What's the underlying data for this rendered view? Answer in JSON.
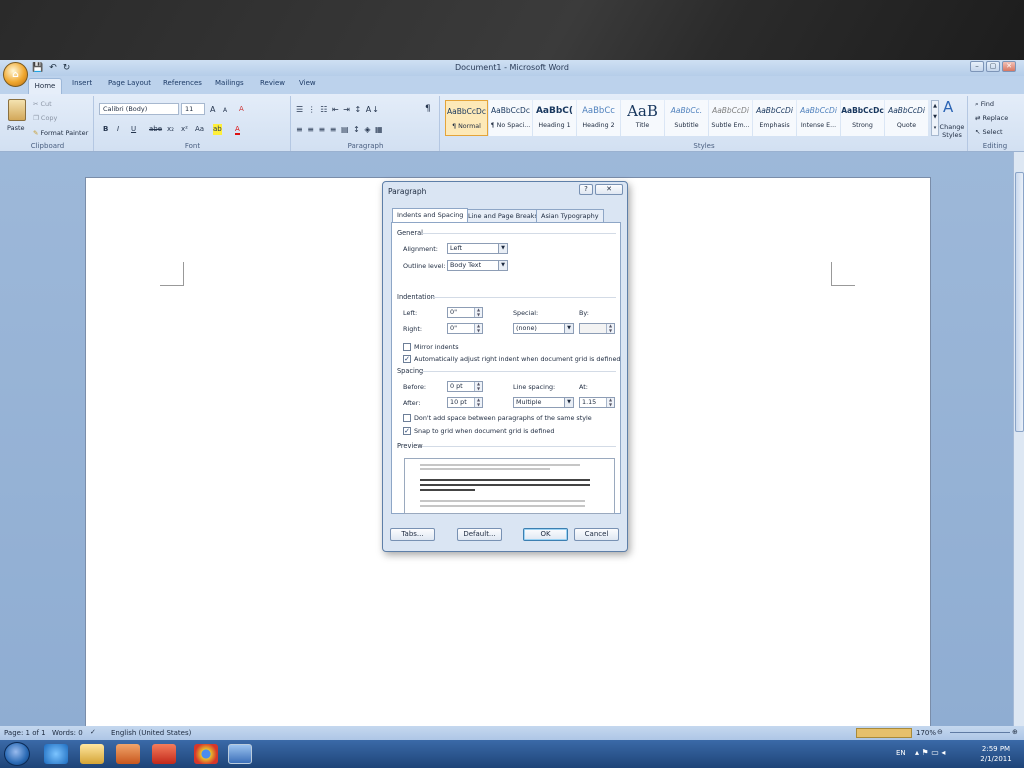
{
  "window": {
    "title": "Document1 - Microsoft Word",
    "controls": [
      "–",
      "▢",
      "✕"
    ]
  },
  "qat": {
    "save": "💾",
    "undo": "↶",
    "redo": "↻"
  },
  "office_button_label": "⌂",
  "tabs": [
    "Home",
    "Insert",
    "Page Layout",
    "References",
    "Mailings",
    "Review",
    "View"
  ],
  "ribbon": {
    "clipboard": {
      "paste": "Paste",
      "cut": "Cut",
      "copy": "Copy",
      "format_painter": "Format Painter",
      "label": "Clipboard"
    },
    "font": {
      "name": "Calibri (Body)",
      "size": "11",
      "label": "Font",
      "bold": "B",
      "italic": "I",
      "underline": "U",
      "strike": "abe",
      "sub": "x₂",
      "sup": "x²",
      "case": "Aa",
      "grow": "A",
      "shrink": "A",
      "clear": "A",
      "highlight": "ab",
      "color": "A"
    },
    "paragraph": {
      "label": "Paragraph",
      "show_marks": "¶"
    },
    "styles": {
      "label": "Styles",
      "items": [
        {
          "preview": "AaBbCcDc",
          "name": "¶ Normal"
        },
        {
          "preview": "AaBbCcDc",
          "name": "¶ No Spaci..."
        },
        {
          "preview": "AaBbC(",
          "name": "Heading 1"
        },
        {
          "preview": "AaBbCc",
          "name": "Heading 2"
        },
        {
          "preview": "AaB",
          "name": "Title"
        },
        {
          "preview": "AaBbCc.",
          "name": "Subtitle"
        },
        {
          "preview": "AaBbCcDi",
          "name": "Subtle Em..."
        },
        {
          "preview": "AaBbCcDi",
          "name": "Emphasis"
        },
        {
          "preview": "AaBbCcDi",
          "name": "Intense E..."
        },
        {
          "preview": "AaBbCcDc",
          "name": "Strong"
        },
        {
          "preview": "AaBbCcDi",
          "name": "Quote"
        }
      ],
      "change_styles": "Change Styles"
    },
    "editing": {
      "label": "Editing",
      "find": "Find",
      "replace": "Replace",
      "select": "Select"
    }
  },
  "dialog": {
    "title": "Paragraph",
    "help": "?",
    "close": "✕",
    "tabs": [
      "Indents and Spacing",
      "Line and Page Breaks",
      "Asian Typography"
    ],
    "general": {
      "heading": "General",
      "alignment_label": "Alignment:",
      "alignment_value": "Left",
      "outline_label": "Outline level:",
      "outline_value": "Body Text"
    },
    "indentation": {
      "heading": "Indentation",
      "left_label": "Left:",
      "left_value": "0\"",
      "right_label": "Right:",
      "right_value": "0\"",
      "special_label": "Special:",
      "special_value": "(none)",
      "by_label": "By:",
      "by_value": "",
      "mirror": "Mirror indents",
      "mirror_checked": false,
      "auto_adjust": "Automatically adjust right indent when document grid is defined",
      "auto_checked": true
    },
    "spacing": {
      "heading": "Spacing",
      "before_label": "Before:",
      "before_value": "0 pt",
      "after_label": "After:",
      "after_value": "10 pt",
      "line_label": "Line spacing:",
      "line_value": "Multiple",
      "at_label": "At:",
      "at_value": "1.15",
      "dont_add": "Don't add space between paragraphs of the same style",
      "dont_add_checked": false,
      "snap": "Snap to grid when document grid is defined",
      "snap_checked": true
    },
    "preview": {
      "heading": "Preview"
    },
    "buttons": {
      "tabs": "Tabs...",
      "default": "Default...",
      "ok": "OK",
      "cancel": "Cancel"
    }
  },
  "statusbar": {
    "page": "Page: 1 of 1",
    "words": "Words: 0",
    "language": "English (United States)",
    "zoom": "170%"
  },
  "taskbar": {
    "lang": "EN",
    "time": "2:59 PM",
    "date": "2/1/2011"
  }
}
